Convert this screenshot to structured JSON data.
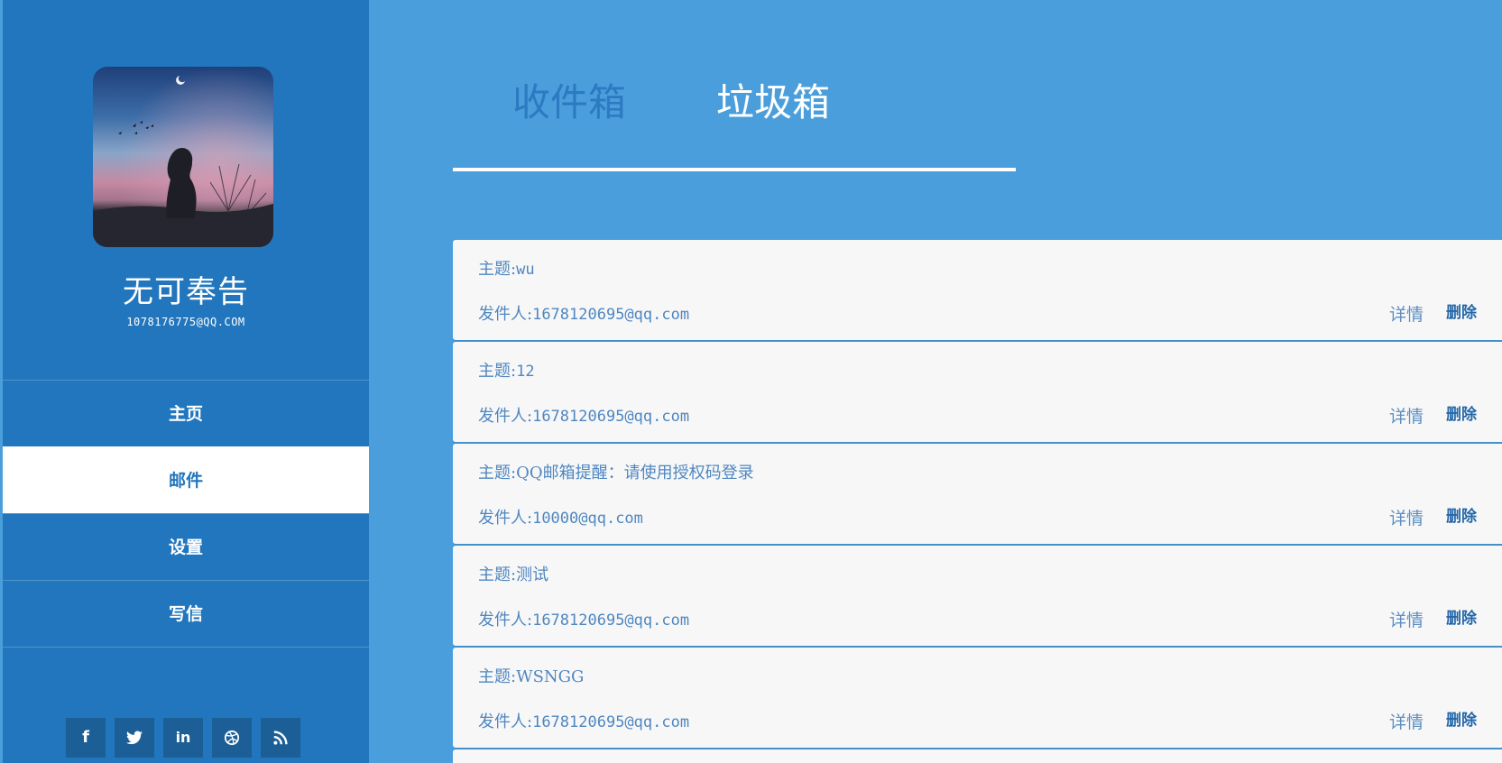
{
  "user": {
    "name": "无可奉告",
    "email": "1078176775@QQ.COM"
  },
  "nav": {
    "items": [
      {
        "label": "主页"
      },
      {
        "label": "邮件"
      },
      {
        "label": "设置"
      },
      {
        "label": "写信"
      }
    ],
    "active": "邮件"
  },
  "social": {
    "icons": [
      "facebook-icon",
      "twitter-icon",
      "linkedin-icon",
      "dribbble-icon",
      "rss-icon"
    ],
    "glyphs": [
      "f",
      "🐦",
      "in",
      "⊛",
      "◉"
    ]
  },
  "tabs": {
    "inbox": "收件箱",
    "trash": "垃圾箱",
    "active": "垃圾箱"
  },
  "mail": {
    "subject_prefix": "主题:",
    "sender_prefix": "发件人:",
    "detail_label": "详情",
    "delete_label": "删除",
    "items": [
      {
        "subject": "wu",
        "sender": "1678120695@qq.com"
      },
      {
        "subject": "12",
        "sender": "1678120695@qq.com"
      },
      {
        "subject": "QQ邮箱提醒：请使用授权码登录",
        "sender": "10000@qq.com"
      },
      {
        "subject": "测试",
        "sender": "1678120695@qq.com"
      },
      {
        "subject": "WSNGG",
        "sender": "1678120695@qq.com"
      }
    ]
  },
  "colors": {
    "sidebar_bg": "#2176bd",
    "main_bg": "#4a9edb",
    "card_bg": "#f7f7f7",
    "accent": "#2467a8"
  }
}
